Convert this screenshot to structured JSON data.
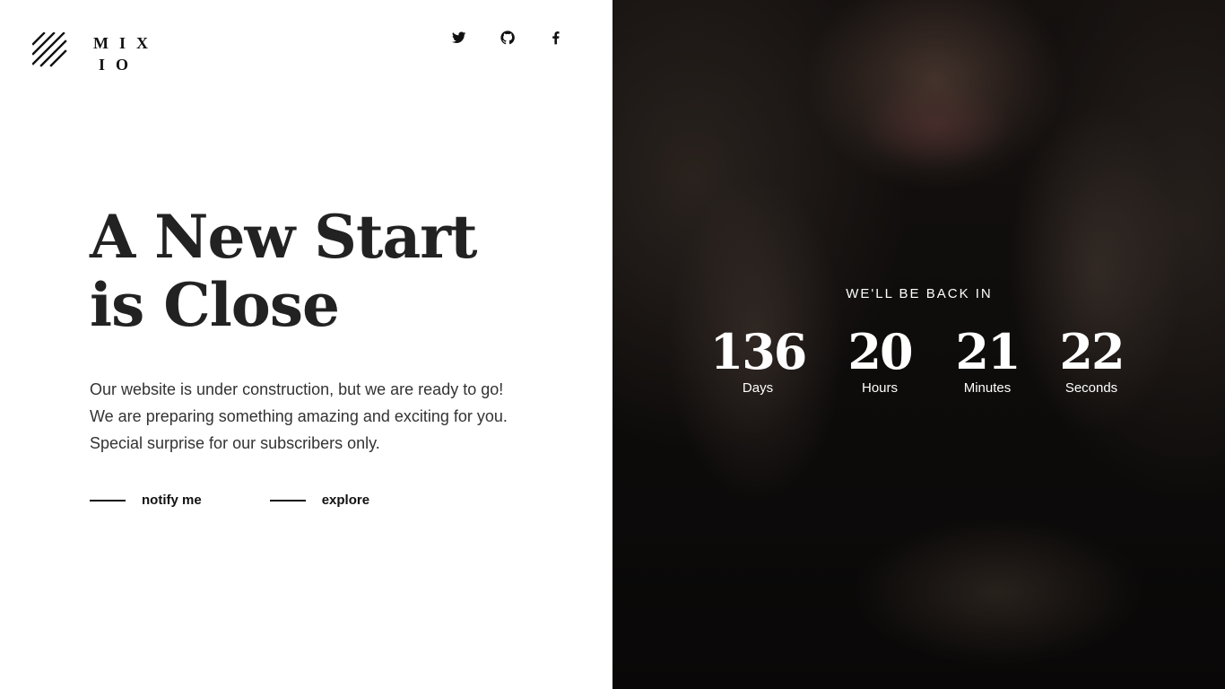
{
  "brand": {
    "logo_line1": "MIX",
    "logo_line2": "IO"
  },
  "social": [
    {
      "icon": "twitter-icon"
    },
    {
      "icon": "github-icon"
    },
    {
      "icon": "facebook-icon"
    }
  ],
  "hero": {
    "headline_line1": "A New Start",
    "headline_line2": "is Close",
    "description": "Our website is under construction, but we are ready to go! We are preparing something amazing and exciting for you. Special surprise for our subscribers only."
  },
  "actions": {
    "notify_label": "notify me",
    "explore_label": "explore"
  },
  "countdown": {
    "title": "WE'LL BE BACK IN",
    "days": "136",
    "days_label": "Days",
    "hours": "20",
    "hours_label": "Hours",
    "minutes": "21",
    "minutes_label": "Minutes",
    "seconds": "22",
    "seconds_label": "Seconds"
  },
  "colors": {
    "text_dark": "#222222",
    "panel_dark": "#141110",
    "text_light": "#ffffff"
  }
}
